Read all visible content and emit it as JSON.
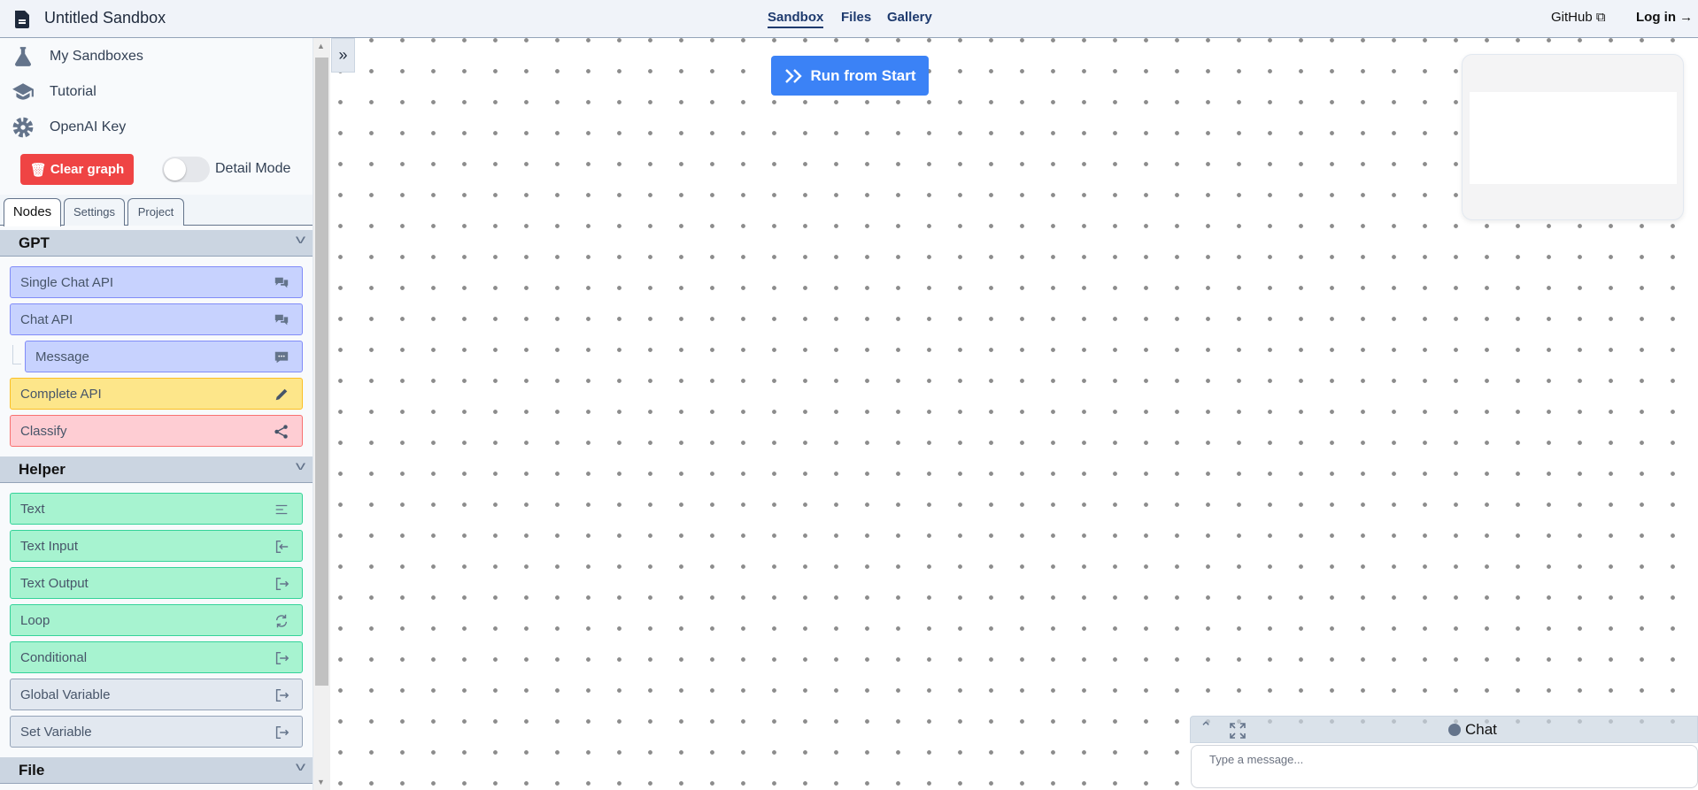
{
  "header": {
    "title": "Untitled Sandbox",
    "nav": [
      {
        "label": "Sandbox",
        "active": true
      },
      {
        "label": "Files"
      },
      {
        "label": "Gallery"
      }
    ],
    "github": "GitHub",
    "login": "Log in"
  },
  "sidebar": {
    "menu": [
      {
        "label": "My Sandboxes",
        "icon": "flask-icon"
      },
      {
        "label": "Tutorial",
        "icon": "graduation-cap-icon"
      },
      {
        "label": "OpenAI Key",
        "icon": "gear-icon"
      }
    ],
    "clear_graph": "Clear graph",
    "detail_mode": "Detail Mode",
    "detail_mode_on": false,
    "tabs": [
      "Nodes",
      "Settings",
      "Project"
    ],
    "active_tab": "Nodes",
    "sections": [
      {
        "title": "GPT",
        "items": [
          {
            "label": "Single Chat API",
            "icon": "chat-bubbles-icon"
          },
          {
            "label": "Chat API",
            "icon": "chat-bubbles-icon"
          },
          {
            "label": "Message",
            "icon": "message-icon"
          },
          {
            "label": "Complete API",
            "icon": "pencil-icon"
          },
          {
            "label": "Classify",
            "icon": "share-icon"
          }
        ]
      },
      {
        "title": "Helper",
        "items": [
          {
            "label": "Text",
            "icon": "align-left-icon"
          },
          {
            "label": "Text Input",
            "icon": "sign-in-icon"
          },
          {
            "label": "Text Output",
            "icon": "sign-out-icon"
          },
          {
            "label": "Loop",
            "icon": "refresh-icon"
          },
          {
            "label": "Conditional",
            "icon": "sign-out-icon"
          },
          {
            "label": "Global Variable",
            "icon": "sign-out-icon"
          },
          {
            "label": "Set Variable",
            "icon": "sign-out-icon"
          }
        ]
      },
      {
        "title": "File",
        "items": []
      }
    ]
  },
  "canvas": {
    "run_button": "Run from Start"
  },
  "chat": {
    "title": "Chat",
    "placeholder": "Type a message..."
  },
  "colors": {
    "accent": "#3b82f6",
    "danger": "#ef4444",
    "gpt": "#c7d2fe",
    "complete": "#fde68a",
    "classify": "#fecdd3",
    "helper": "#a7f3d0",
    "variable": "#e2e8f0"
  }
}
